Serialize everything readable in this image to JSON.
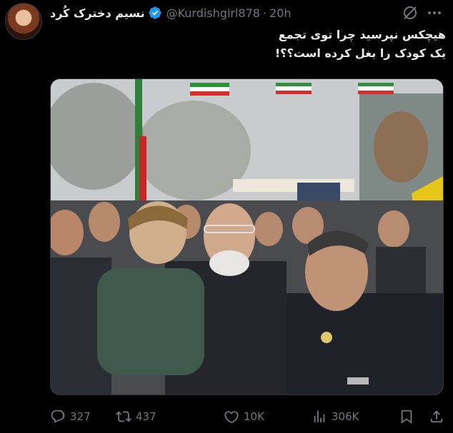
{
  "tweet": {
    "display_name": "نسیم دخترک کُرد",
    "handle": "@Kurdishgirl878",
    "separator": "·",
    "time": "20h",
    "text_lines": [
      "هیچکس نپرسید چرا توی تجمع",
      "یک کودک را بغل کرده است؟؟!"
    ]
  },
  "stats": {
    "replies": "327",
    "retweets": "437",
    "likes": "10K",
    "views": "306K"
  },
  "icons": {
    "verified": "verified-badge-icon",
    "grok": "grok-icon",
    "more": "more-icon",
    "reply": "reply-icon",
    "retweet": "retweet-icon",
    "like": "heart-icon",
    "views": "views-icon",
    "bookmark": "bookmark-icon",
    "share": "share-icon"
  },
  "colors": {
    "background": "#000000",
    "text": "#e7e9ea",
    "muted": "#71767b",
    "verified": "#1d9bf0"
  }
}
